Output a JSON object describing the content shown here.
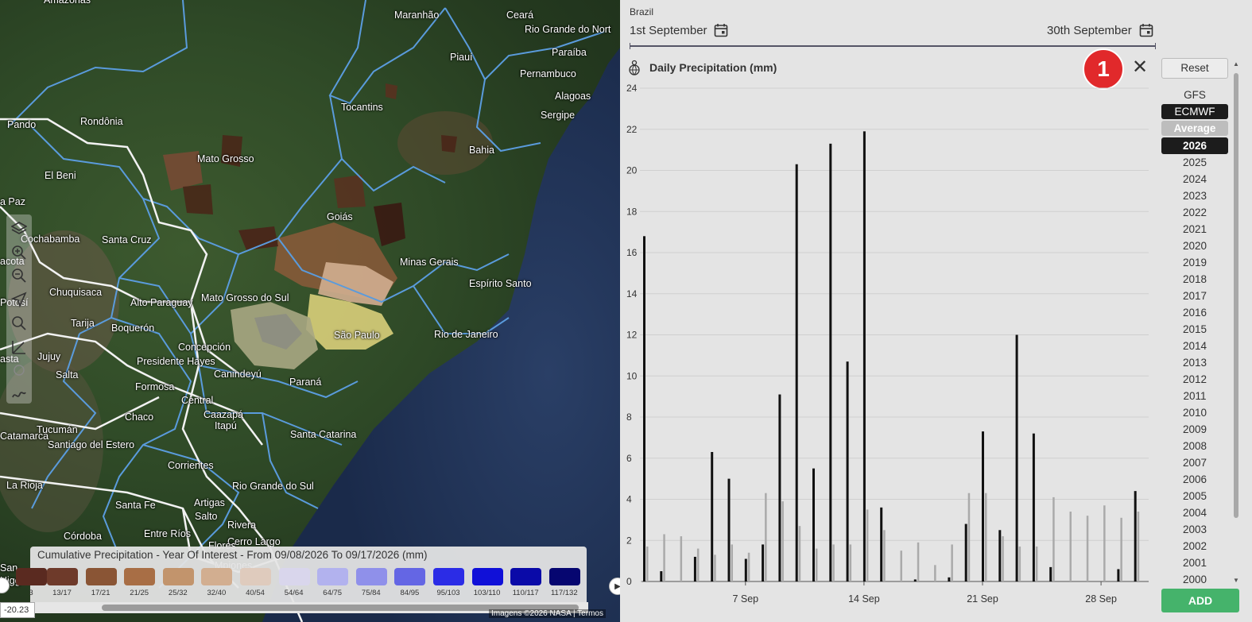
{
  "map": {
    "labels": [
      {
        "text": "Amazonas"
      },
      {
        "text": "Maranhão"
      },
      {
        "text": "Ceará"
      },
      {
        "text": "Rio Grande do Nort"
      },
      {
        "text": "Paraíba"
      },
      {
        "text": "Piauí"
      },
      {
        "text": "Pernambuco"
      },
      {
        "text": "Alagoas"
      },
      {
        "text": "Sergipe"
      },
      {
        "text": "Tocantins"
      },
      {
        "text": "Rondônia"
      },
      {
        "text": "Pando"
      },
      {
        "text": "Bahia"
      },
      {
        "text": "Mato Grosso"
      },
      {
        "text": "El Beni"
      },
      {
        "text": "a Paz"
      },
      {
        "text": "Goiás"
      },
      {
        "text": "Cochabamba"
      },
      {
        "text": "Santa Cruz"
      },
      {
        "text": "Minas Gerais"
      },
      {
        "text": "acota"
      },
      {
        "text": "Espírito Santo"
      },
      {
        "text": "Chuquisaca"
      },
      {
        "text": "Mato Grosso do Sul"
      },
      {
        "text": "Potosí"
      },
      {
        "text": "Alto Paraguay"
      },
      {
        "text": "Tarija"
      },
      {
        "text": "Boquerón"
      },
      {
        "text": "São Paulo"
      },
      {
        "text": "Rio de Janeiro"
      },
      {
        "text": "Concepción"
      },
      {
        "text": "Jujuy"
      },
      {
        "text": "asta"
      },
      {
        "text": "Presidente Hayes"
      },
      {
        "text": "Canindeyú"
      },
      {
        "text": "Salta"
      },
      {
        "text": "Paraná"
      },
      {
        "text": "Formosa"
      },
      {
        "text": "Central"
      },
      {
        "text": "Caazapá"
      },
      {
        "text": "Itapú"
      },
      {
        "text": "Chaco"
      },
      {
        "text": "Santa Catarina"
      },
      {
        "text": "Catamarca"
      },
      {
        "text": "Tucumán"
      },
      {
        "text": "Santiago del Estero"
      },
      {
        "text": "Corrientes"
      },
      {
        "text": "La Rioja"
      },
      {
        "text": "Rio Grande do Sul"
      },
      {
        "text": "Santa Fe"
      },
      {
        "text": "Artigas"
      },
      {
        "text": "Salto"
      },
      {
        "text": "Rivera"
      },
      {
        "text": "Córdoba"
      },
      {
        "text": "Entre Ríos"
      },
      {
        "text": "Cerro Largo"
      },
      {
        "text": "San"
      },
      {
        "text": "Higgi"
      },
      {
        "text": "Flores"
      },
      {
        "text": "Mpiones"
      }
    ],
    "legend": {
      "title": "Cumulative Precipitation - Year Of Interest - From 09/08/2026 To 09/17/2026 (mm)",
      "bins": [
        {
          "label": "3",
          "color": "#5a2a20"
        },
        {
          "label": "13/17",
          "color": "#6e3a2a"
        },
        {
          "label": "17/21",
          "color": "#8a5535"
        },
        {
          "label": "21/25",
          "color": "#a86e45"
        },
        {
          "label": "25/32",
          "color": "#c2946c"
        },
        {
          "label": "32/40",
          "color": "#d2ae90"
        },
        {
          "label": "40/54",
          "color": "#dfcbbd"
        },
        {
          "label": "54/64",
          "color": "#d9d6ec"
        },
        {
          "label": "64/75",
          "color": "#b2b2ee"
        },
        {
          "label": "75/84",
          "color": "#8f90ea"
        },
        {
          "label": "84/95",
          "color": "#6466e4"
        },
        {
          "label": "95/103",
          "color": "#2b2ce6"
        },
        {
          "label": "103/110",
          "color": "#1010d8"
        },
        {
          "label": "110/117",
          "color": "#0a0aa8"
        },
        {
          "label": "117/132",
          "color": "#060670"
        }
      ]
    },
    "coordinate_value": "-20.23",
    "attribution": "Imagens ©2026 NASA | Termos"
  },
  "panel": {
    "region": "Brazil",
    "start_date": "1st September",
    "end_date": "30th September",
    "chart_title": "Daily Precipitation (mm)",
    "badge_number": "1",
    "close_label": "✕",
    "reset_label": "Reset",
    "models": [
      "GFS",
      "ECMWF",
      "Average"
    ],
    "selected_model": "ECMWF",
    "years": [
      "2026",
      "2025",
      "2024",
      "2023",
      "2022",
      "2021",
      "2020",
      "2019",
      "2018",
      "2017",
      "2016",
      "2015",
      "2014",
      "2013",
      "2012",
      "2011",
      "2010",
      "2009",
      "2008",
      "2007",
      "2006",
      "2005",
      "2004",
      "2003",
      "2002",
      "2001",
      "2000"
    ],
    "selected_year": "2026",
    "add_label": "ADD"
  },
  "chart_data": {
    "type": "bar",
    "title": "Daily Precipitation (mm)",
    "ylim": [
      0,
      24
    ],
    "yticks": [
      0,
      2,
      4,
      6,
      8,
      10,
      12,
      14,
      16,
      18,
      20,
      22,
      24
    ],
    "xticks": [
      {
        "day": 7,
        "label": "7 Sep"
      },
      {
        "day": 14,
        "label": "14 Sep"
      },
      {
        "day": 21,
        "label": "21 Sep"
      },
      {
        "day": 28,
        "label": "28 Sep"
      }
    ],
    "days": [
      1,
      2,
      3,
      4,
      5,
      6,
      7,
      8,
      9,
      10,
      11,
      12,
      13,
      14,
      15,
      16,
      17,
      18,
      19,
      20,
      21,
      22,
      23,
      24,
      25,
      26,
      27,
      28,
      29,
      30
    ],
    "series": [
      {
        "name": "2026",
        "color": "#111111",
        "values": [
          16.8,
          0.5,
          0,
          1.2,
          6.3,
          5.0,
          1.1,
          1.8,
          9.1,
          20.3,
          5.5,
          21.3,
          10.7,
          21.9,
          3.6,
          0,
          0.1,
          0,
          0.2,
          2.8,
          7.3,
          2.5,
          12.0,
          7.2,
          0.7,
          0,
          0,
          0,
          0.6,
          4.4
        ]
      },
      {
        "name": "Average",
        "color": "#aaaaaa",
        "values": [
          1.7,
          2.3,
          2.2,
          1.6,
          1.3,
          1.8,
          1.4,
          4.3,
          3.9,
          2.7,
          1.6,
          1.8,
          1.8,
          3.5,
          2.5,
          1.5,
          1.9,
          0.8,
          1.8,
          4.3,
          4.3,
          2.2,
          1.7,
          1.7,
          4.1,
          3.4,
          3.2,
          3.7,
          3.1,
          3.4
        ]
      }
    ]
  }
}
